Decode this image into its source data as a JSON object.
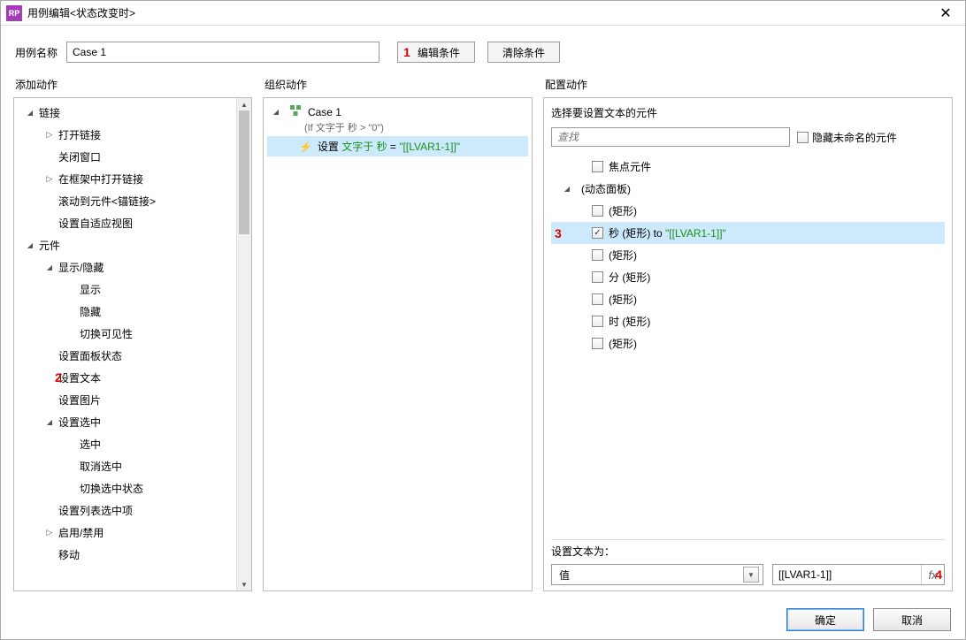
{
  "window": {
    "icon_text": "RP",
    "title": "用例编辑<状态改变时>"
  },
  "top": {
    "case_name_label": "用例名称",
    "case_name_value": "Case 1",
    "edit_condition": "编辑条件",
    "clear_condition": "清除条件",
    "annot1": "1"
  },
  "left": {
    "title": "添加动作",
    "items": [
      {
        "label": "链接",
        "level": 1,
        "exp": "open"
      },
      {
        "label": "打开链接",
        "level": 2,
        "exp": "closed"
      },
      {
        "label": "关闭窗口",
        "level": 2,
        "exp": "none"
      },
      {
        "label": "在框架中打开链接",
        "level": 2,
        "exp": "closed"
      },
      {
        "label": "滚动到元件<锚链接>",
        "level": 2,
        "exp": "none"
      },
      {
        "label": "设置自适应视图",
        "level": 2,
        "exp": "none"
      },
      {
        "label": "元件",
        "level": 1,
        "exp": "open"
      },
      {
        "label": "显示/隐藏",
        "level": 2,
        "exp": "open"
      },
      {
        "label": "显示",
        "level": 3,
        "exp": "none"
      },
      {
        "label": "隐藏",
        "level": 3,
        "exp": "none"
      },
      {
        "label": "切换可见性",
        "level": 3,
        "exp": "none"
      },
      {
        "label": "设置面板状态",
        "level": 2,
        "exp": "none"
      },
      {
        "label": "设置文本",
        "level": 2,
        "exp": "none",
        "annot": "2"
      },
      {
        "label": "设置图片",
        "level": 2,
        "exp": "none"
      },
      {
        "label": "设置选中",
        "level": 2,
        "exp": "open"
      },
      {
        "label": "选中",
        "level": 3,
        "exp": "none"
      },
      {
        "label": "取消选中",
        "level": 3,
        "exp": "none"
      },
      {
        "label": "切换选中状态",
        "level": 3,
        "exp": "none"
      },
      {
        "label": "设置列表选中项",
        "level": 2,
        "exp": "none"
      },
      {
        "label": "启用/禁用",
        "level": 2,
        "exp": "closed"
      },
      {
        "label": "移动",
        "level": 2,
        "exp": "none"
      }
    ]
  },
  "mid": {
    "title": "组织动作",
    "case_name": "Case 1",
    "condition": "(If 文字于 秒 > \"0\")",
    "action_prefix": "设置 ",
    "action_green1": "文字于 秒",
    "action_mid": " = ",
    "action_green2": "\"[[LVAR1-1]]\""
  },
  "right": {
    "title": "配置动作",
    "subheading": "选择要设置文本的元件",
    "search_placeholder": "查找",
    "hide_unnamed": "隐藏未命名的元件",
    "widgets": [
      {
        "label": "焦点元件",
        "level": 2,
        "exp": "none",
        "checkbox": true
      },
      {
        "label": "(动态面板)",
        "level": 1,
        "exp": "open",
        "checkbox": false
      },
      {
        "label": "(矩形)",
        "level": 2,
        "exp": "none",
        "checkbox": true
      },
      {
        "label_pre": "秒 (矩形) to ",
        "label_green": "\"[[LVAR1-1]]\"",
        "level": 2,
        "exp": "none",
        "checkbox": true,
        "checked": true,
        "selected": true,
        "annot": "3"
      },
      {
        "label": "(矩形)",
        "level": 2,
        "exp": "none",
        "checkbox": true
      },
      {
        "label": "分 (矩形)",
        "level": 2,
        "exp": "none",
        "checkbox": true
      },
      {
        "label": "(矩形)",
        "level": 2,
        "exp": "none",
        "checkbox": true
      },
      {
        "label": "时 (矩形)",
        "level": 2,
        "exp": "none",
        "checkbox": true
      },
      {
        "label": "(矩形)",
        "level": 2,
        "exp": "none",
        "checkbox": true
      }
    ],
    "set_text_label": "设置文本为：",
    "dropdown_value": "值",
    "value_input": "[[LVAR1-1]]",
    "fx_label": "fx",
    "annot4": "4"
  },
  "footer": {
    "ok": "确定",
    "cancel": "取消"
  }
}
